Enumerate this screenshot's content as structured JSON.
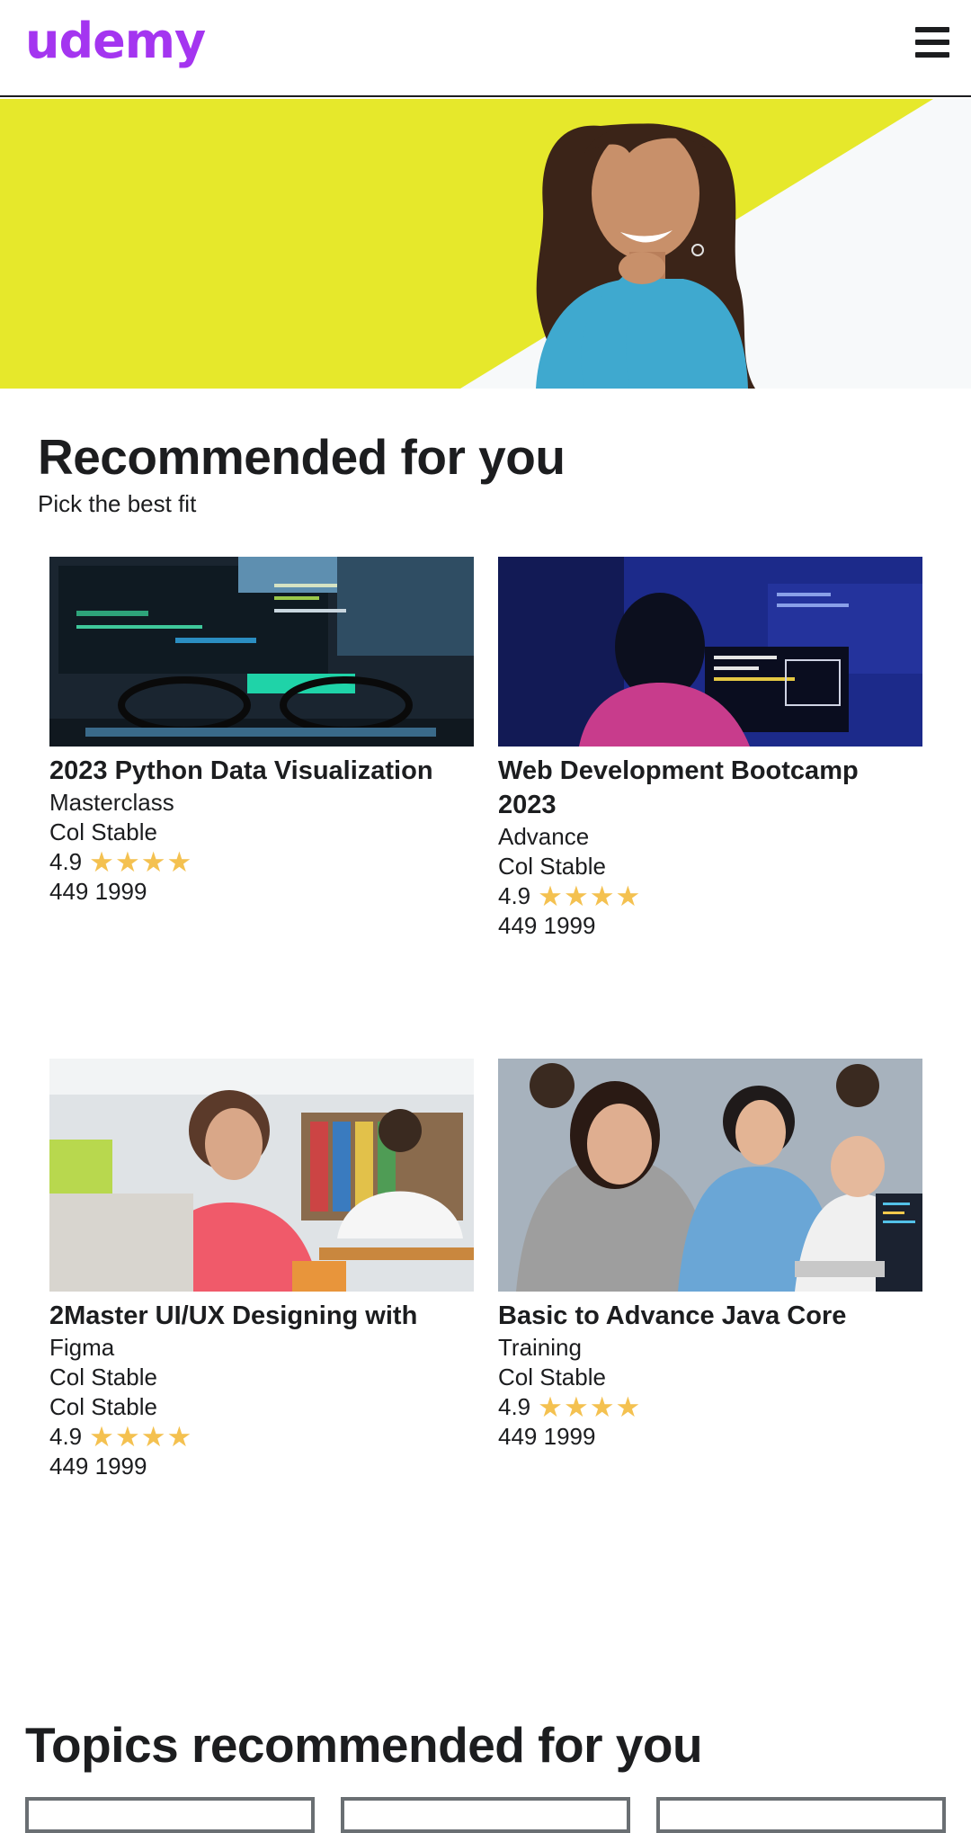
{
  "header": {
    "logo": "udemy",
    "menu_icon": "hamburger-menu-icon"
  },
  "colors": {
    "brand": "#a435f0",
    "hero_yellow": "#e6e82b",
    "star": "#f4c150"
  },
  "recommended": {
    "title": "Recommended for you",
    "subtitle": "Pick the best fit"
  },
  "courses": [
    {
      "title": "2023 Python Data Visualization",
      "lines": [
        "Masterclass",
        "Col Stable"
      ],
      "rating": "4.9",
      "stars": "★★★★",
      "price": "449 1999"
    },
    {
      "title": "Web Development Bootcamp 2023",
      "lines": [
        "Advance",
        "Col Stable"
      ],
      "rating": "4.9",
      "stars": "★★★★",
      "price": "449 1999"
    },
    {
      "title": "2Master UI/UX Designing with",
      "lines": [
        "Figma",
        "Col Stable",
        "Col Stable"
      ],
      "rating": "4.9",
      "stars": "★★★★",
      "price": "449 1999"
    },
    {
      "title": "Basic to Advance Java Core",
      "lines": [
        "Training",
        "Col Stable"
      ],
      "rating": "4.9",
      "stars": "★★★★",
      "price": "449 1999"
    }
  ],
  "topics": {
    "title": "Topics recommended for you"
  }
}
